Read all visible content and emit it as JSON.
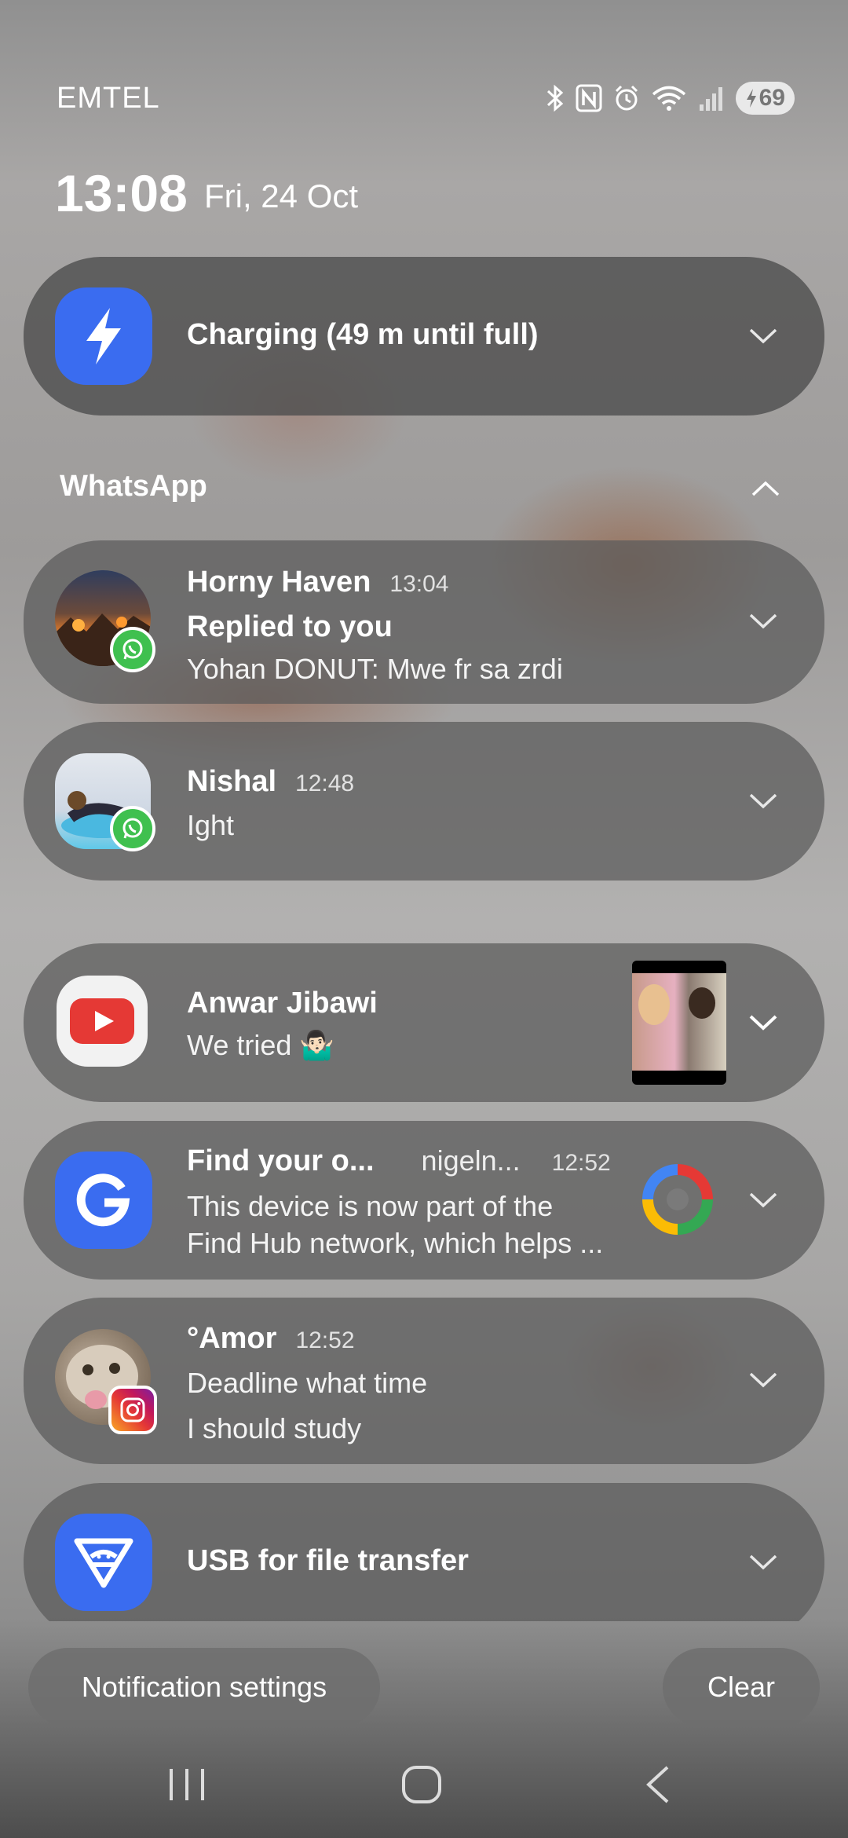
{
  "status_bar": {
    "carrier": "EMTEL",
    "battery": "69",
    "icons": [
      "bluetooth-icon",
      "nfc-icon",
      "alarm-icon",
      "wifi-icon",
      "signal-icon",
      "battery-icon"
    ]
  },
  "header": {
    "time": "13:08",
    "date": "Fri, 24 Oct"
  },
  "charging": {
    "title": "Charging (49 m until full)",
    "icon": "lightning-icon",
    "color": "#3a6cf0"
  },
  "whatsapp": {
    "label": "WhatsApp",
    "items": [
      {
        "title": "Horny Haven",
        "time": "13:04",
        "line1": "Replied to you",
        "line2": "Yohan DONUT: Mwe fr sa zrdi"
      },
      {
        "title": "Nishal",
        "time": "12:48",
        "line1": "Ight"
      }
    ]
  },
  "youtube": {
    "title": "Anwar Jibawi",
    "text": "We tried 🤷🏻‍♂️"
  },
  "google": {
    "title": "Find your o...",
    "account": "nigeln...",
    "time": "12:52",
    "line1": "This device is now part of the",
    "line2": "Find Hub network, which helps ..."
  },
  "instagram": {
    "title": "°Amor",
    "time": "12:52",
    "line1": "Deadline what time",
    "line2": "I should study"
  },
  "usb": {
    "title": "USB for file transfer"
  },
  "footer": {
    "settings": "Notification settings",
    "clear": "Clear"
  },
  "colors": {
    "blue_icon": "#3a6cf0",
    "whatsapp_green": "#3fc04f",
    "youtube_red": "#e53935"
  }
}
